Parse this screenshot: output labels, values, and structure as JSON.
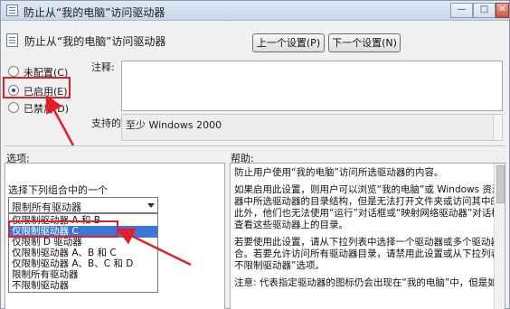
{
  "window": {
    "title": "防止从“我的电脑”访问驱动器",
    "min_label": "—",
    "max_label": "□",
    "close_label": "✕"
  },
  "setting": {
    "title": "防止从“我的电脑”访问驱动器"
  },
  "buttons": {
    "prev": "上一个设置(P)",
    "next": "下一个设置(N)"
  },
  "radios": [
    {
      "label": "未配置(C)",
      "checked": false
    },
    {
      "label": "已启用(E)",
      "checked": true
    },
    {
      "label": "已禁用(D)",
      "checked": false
    }
  ],
  "labels": {
    "comment": "注释:",
    "platform": "支持的平台:",
    "options": "选项:",
    "help": "帮助:"
  },
  "platform_value": "至少 Windows 2000",
  "options": {
    "heading": "选择下列组合中的一个",
    "dropdown_value": "限制所有驱动器",
    "list": [
      "仅限制驱动器 A 和 B",
      "仅限制驱动器 C",
      "仅限制 D 驱动器",
      "仅限制驱动器 A、B 和 C",
      "仅限制驱动器 A、B、C 和 D",
      "限制所有驱动器",
      "不限制驱动器"
    ],
    "selected_index": 1
  },
  "help": {
    "paragraphs": [
      "防止用户使用“我的电脑”访问所选驱动器的内容。",
      "如果启用此设置，则用户可以浏览“我的电脑”或 Windows 资源管理\n器中所选驱动器的目录结构，但是无法打开文件夹或访问其中的内容。\n此外，他们也无法使用“运行”对话框或“映射网络驱动器”对话框来\n查看这些驱动器上的目录。",
      "若要使用此设置，请从下拉列表中选择一个驱动器或多个驱动器的组\n合。若要允许访问所有驱动器目录，请禁用此设置或从下拉列表中选择“\n不限制驱动器”选项。",
      "注意: 代表指定驱动器的图标仍会出现在“我的电脑”中，但是如果用户"
    ]
  },
  "colors": {
    "annotation_red": "#e31f2b",
    "selection_blue": "#3b78d8"
  }
}
